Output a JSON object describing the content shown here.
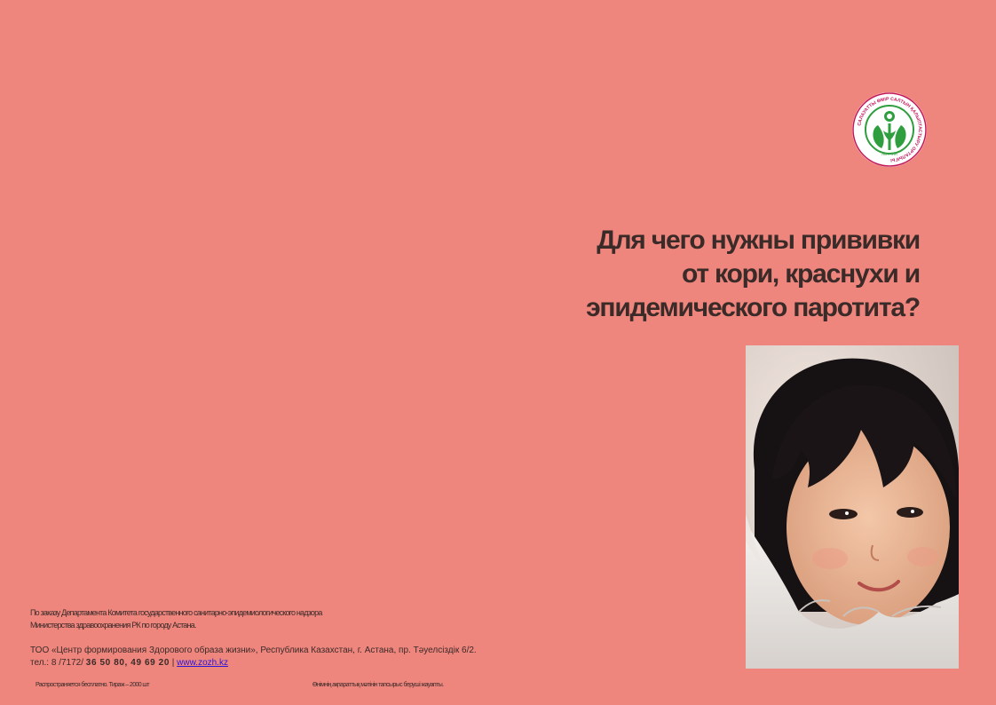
{
  "logo": {
    "ring_text": "САЛАУАТТЫ ӨМІР САЛТЫН ҚАЛЫПТАСТЫРУ ОРТАЛЫҒЫ",
    "city": "АСТАНА",
    "colors": {
      "ring": "#c2185b",
      "emblem": "#2e9e3e",
      "inner": "#ffffff"
    }
  },
  "title": {
    "line1": "Для чего нужны прививки",
    "line2": "от кори, краснухи и",
    "line3": "эпидемического паротита?"
  },
  "photo": {
    "alt": "child-photo"
  },
  "footer": {
    "order_line1": "По заказу Департамента Комитета государственного санитарно-эпидемиологического надзора",
    "order_line2": "Министерства здравоохранения РК по городу Астана.",
    "address": "ТОО «Центр формирования Здорового образа жизни», Республика Казахстан, г. Астана, пр. Тәуелсіздік 6/2.",
    "phone_prefix": "тел.: 8 /7172/ ",
    "phone_numbers": "36 50 80, 49 69 20",
    "separator": " | ",
    "website": "www.zozh.kz",
    "distribution": "Распространяется бесплатно. Тираж – 2000 шт",
    "kazakh_note": "Өнімнің ақпараттық мәтінін тапсырыс беруші жауапты."
  }
}
